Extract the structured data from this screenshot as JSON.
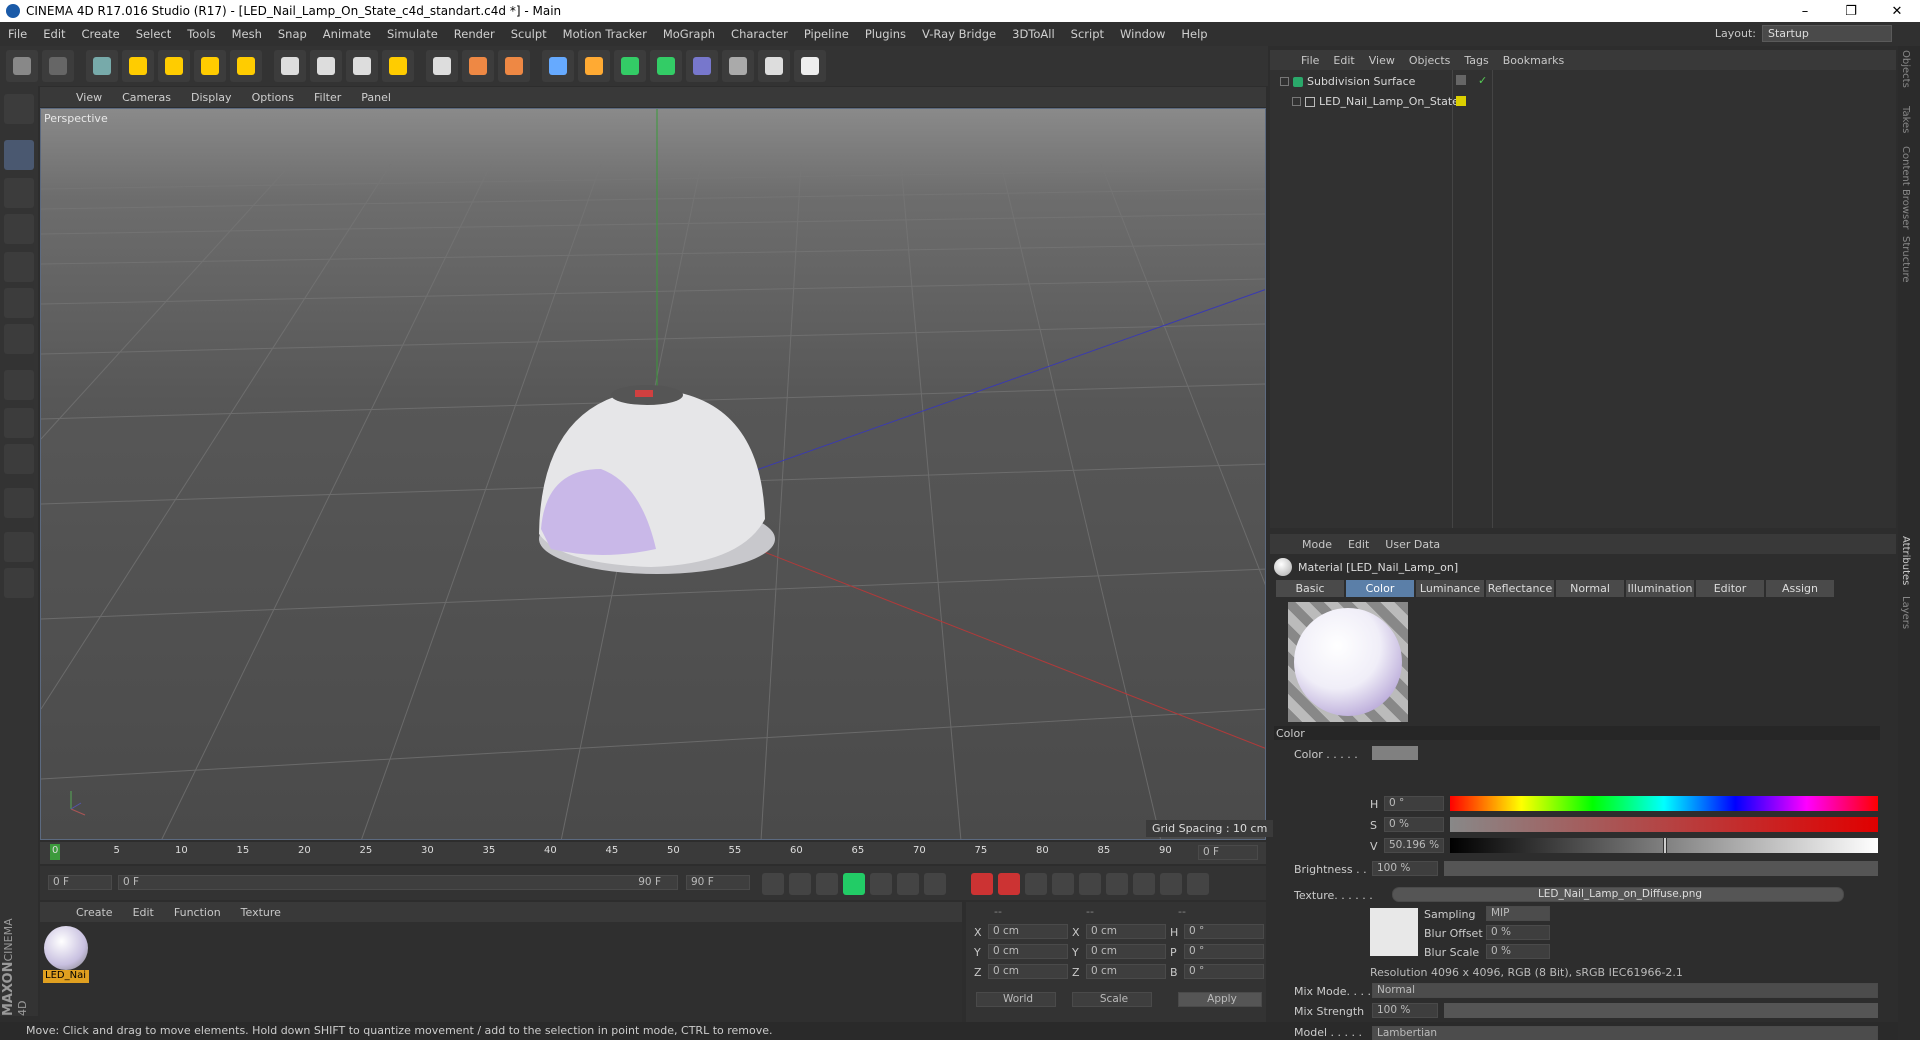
{
  "window": {
    "title": "CINEMA 4D R17.016 Studio (R17) - [LED_Nail_Lamp_On_State_c4d_standart.c4d *] - Main",
    "minimize": "–",
    "maximize": "❐",
    "close": "✕"
  },
  "menubar": {
    "items": [
      "File",
      "Edit",
      "Create",
      "Select",
      "Tools",
      "Mesh",
      "Snap",
      "Animate",
      "Simulate",
      "Render",
      "Sculpt",
      "Motion Tracker",
      "MoGraph",
      "Character",
      "Pipeline",
      "Plugins",
      "V-Ray Bridge",
      "3DToAll",
      "Script",
      "Window",
      "Help"
    ],
    "layout_label": "Layout:",
    "layout_value": "Startup"
  },
  "toolbar": {
    "icons": [
      "undo-icon",
      "redo-icon",
      "select-icon",
      "move-icon",
      "scale-icon",
      "rotate-icon",
      "live-select-icon",
      "x-axis-icon",
      "y-axis-icon",
      "z-axis-icon",
      "world-coord-icon",
      "render-view-icon",
      "render-picture-queue-icon",
      "render-settings-icon",
      "cube-icon",
      "pen-icon",
      "subdivision-icon",
      "array-icon",
      "deformer-icon",
      "floor-icon",
      "camera-icon",
      "light-icon"
    ]
  },
  "viewport": {
    "menu": [
      "View",
      "Cameras",
      "Display",
      "Options",
      "Filter",
      "Panel"
    ],
    "label": "Perspective",
    "grid_spacing": "Grid Spacing : 10 cm",
    "axis_x": "x",
    "axis_y": "y",
    "axis_z": "z"
  },
  "timeline": {
    "ticks": [
      "0",
      "5",
      "10",
      "15",
      "20",
      "25",
      "30",
      "35",
      "40",
      "45",
      "50",
      "55",
      "60",
      "65",
      "70",
      "75",
      "80",
      "85",
      "90"
    ],
    "current": "0 F"
  },
  "transport": {
    "start": "0 F",
    "range_start": "0 F",
    "range_end": "90 F",
    "end": "90 F"
  },
  "material_manager": {
    "menu": [
      "Create",
      "Edit",
      "Function",
      "Texture"
    ],
    "material_name": "LED_Nai"
  },
  "coordinates": {
    "headers": [
      "--",
      "--",
      "--"
    ],
    "rows": [
      {
        "a": "X",
        "av": "0 cm",
        "b": "X",
        "bv": "0 cm",
        "c": "H",
        "cv": "0 °"
      },
      {
        "a": "Y",
        "av": "0 cm",
        "b": "Y",
        "bv": "0 cm",
        "c": "P",
        "cv": "0 °"
      },
      {
        "a": "Z",
        "av": "0 cm",
        "b": "Z",
        "bv": "0 cm",
        "c": "B",
        "cv": "0 °"
      }
    ],
    "world": "World",
    "scale": "Scale",
    "apply": "Apply"
  },
  "status": "Move: Click and drag to move elements. Hold down SHIFT to quantize movement / add to the selection in point mode, CTRL to remove.",
  "object_manager": {
    "menu": [
      "File",
      "Edit",
      "View",
      "Objects",
      "Tags",
      "Bookmarks"
    ],
    "objects": [
      {
        "name": "Subdivision Surface"
      },
      {
        "name": "LED_Nail_Lamp_On_State"
      }
    ]
  },
  "attributes": {
    "menu": [
      "Mode",
      "Edit",
      "User Data"
    ],
    "material_title": "Material [LED_Nail_Lamp_on]",
    "tabs": [
      "Basic",
      "Color",
      "Luminance",
      "Reflectance",
      "Normal",
      "Illumination",
      "Editor",
      "Assign"
    ],
    "active_tab": "Color",
    "section": "Color",
    "color_label": "Color . . . . .",
    "h_label": "H",
    "h_value": "0 °",
    "s_label": "S",
    "s_value": "0 %",
    "v_label": "V",
    "v_value": "50.196 %",
    "brightness_label": "Brightness . .",
    "brightness_value": "100 %",
    "texture_label": "Texture. . . . . .",
    "texture_file": "LED_Nail_Lamp_on_Diffuse.png",
    "sampling_label": "Sampling",
    "sampling_value": "MIP",
    "blur_offset_label": "Blur Offset",
    "blur_offset_value": "0 %",
    "blur_scale_label": "Blur Scale",
    "blur_scale_value": "0 %",
    "resolution": "Resolution 4096 x 4096, RGB (8 Bit), sRGB IEC61966-2.1",
    "mix_mode_label": "Mix Mode. . . .",
    "mix_mode_value": "Normal",
    "mix_strength_label": "Mix Strength",
    "mix_strength_value": "100 %",
    "model_label": "Model . . . . .",
    "model_value": "Lambertian"
  },
  "right_tabs": [
    "Objects",
    "Takes",
    "Content Browser",
    "Structure",
    "Attributes",
    "Layers"
  ],
  "brand": {
    "line1": "MAXON",
    "line2": "CINEMA 4D"
  }
}
